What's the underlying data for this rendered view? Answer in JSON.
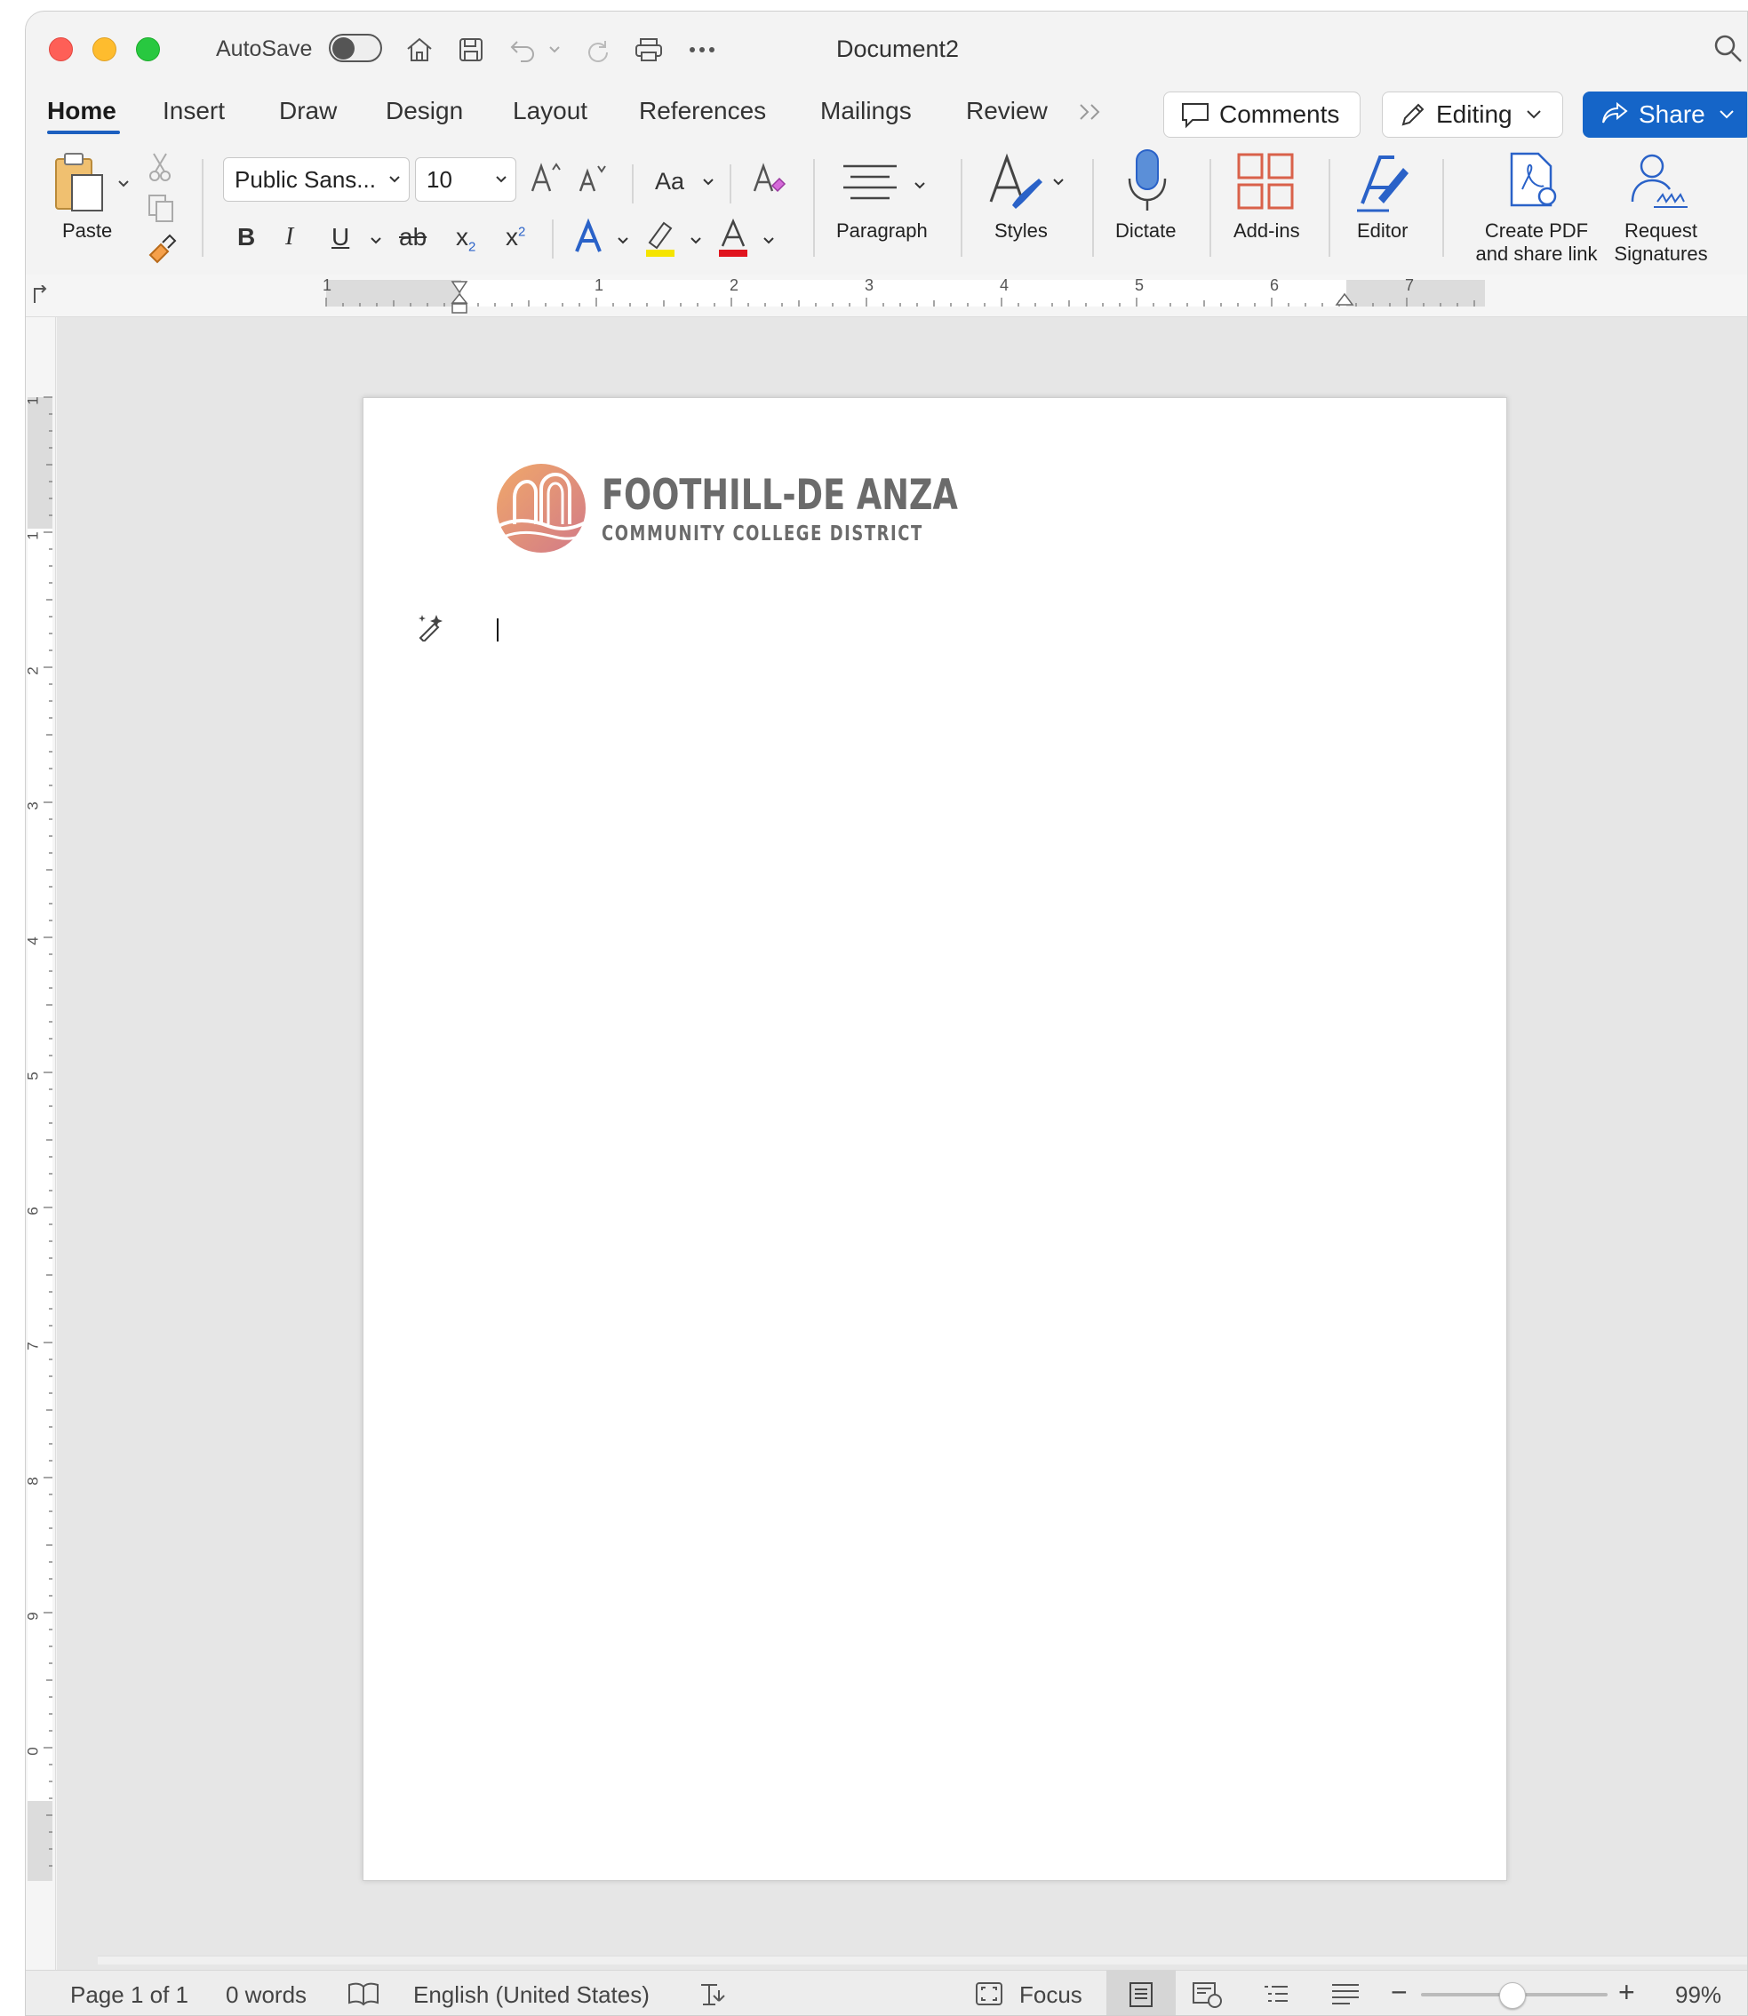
{
  "title_bar": {
    "autosave_label": "AutoSave",
    "document_title": "Document2"
  },
  "tabs": [
    {
      "label": "Home"
    },
    {
      "label": "Insert"
    },
    {
      "label": "Draw"
    },
    {
      "label": "Design"
    },
    {
      "label": "Layout"
    },
    {
      "label": "References"
    },
    {
      "label": "Mailings"
    },
    {
      "label": "Review"
    }
  ],
  "actions": {
    "comments_label": "Comments",
    "editing_label": "Editing",
    "share_label": "Share"
  },
  "ribbon": {
    "paste_label": "Paste",
    "font_name": "Public Sans...",
    "font_size": "10",
    "paragraph_label": "Paragraph",
    "styles_label": "Styles",
    "dictate_label": "Dictate",
    "addins_label": "Add-ins",
    "editor_label": "Editor",
    "create_pdf_label_1": "Create PDF",
    "create_pdf_label_2": "and share link",
    "request_sig_label_1": "Request",
    "request_sig_label_2": "Signatures",
    "change_case_label": "Aa",
    "bold": "B",
    "italic": "I",
    "underline": "U",
    "strike": "ab",
    "subscript": "x",
    "superscript": "x"
  },
  "ruler": {
    "h_numbers": [
      "1",
      "1",
      "2",
      "3",
      "4",
      "5",
      "6",
      "7"
    ],
    "v_numbers": [
      "1",
      "1",
      "2",
      "3",
      "4",
      "5",
      "6",
      "7",
      "8",
      "9",
      "0"
    ]
  },
  "document": {
    "logo_line1": "FOOTHILL-DE ANZA",
    "logo_line2": "COMMUNITY COLLEGE DISTRICT"
  },
  "status_bar": {
    "page": "Page 1 of 1",
    "words": "0 words",
    "language": "English (United States)",
    "focus": "Focus",
    "zoom": "99%"
  },
  "colors": {
    "accent": "#1565c8",
    "highlight": "#f5e400",
    "font_color": "#e0141e",
    "addins": "#d9614a"
  }
}
